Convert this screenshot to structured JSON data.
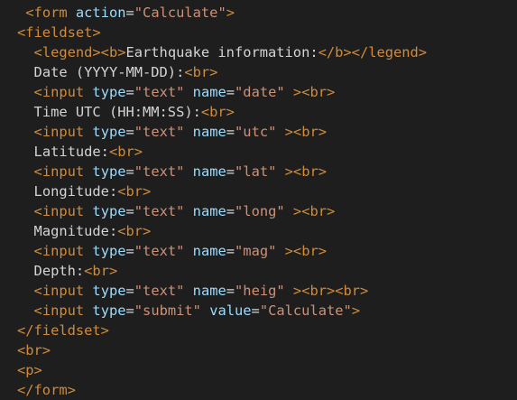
{
  "lines": [
    [
      {
        "t": " ",
        "c": "txt"
      },
      {
        "t": "<form ",
        "c": "tag"
      },
      {
        "t": "action",
        "c": "attr"
      },
      {
        "t": "=",
        "c": "eq"
      },
      {
        "t": "\"Calculate\"",
        "c": "str"
      },
      {
        "t": ">",
        "c": "tag"
      }
    ],
    [
      {
        "t": "<fieldset>",
        "c": "tag"
      }
    ],
    [
      {
        "t": "  ",
        "c": "txt"
      },
      {
        "t": "<legend><b>",
        "c": "tag"
      },
      {
        "t": "Earthquake information:",
        "c": "txt"
      },
      {
        "t": "</b></legend>",
        "c": "tag"
      }
    ],
    [
      {
        "t": "  ",
        "c": "txt"
      },
      {
        "t": "Date (YYYY-MM-DD):",
        "c": "txt"
      },
      {
        "t": "<br>",
        "c": "tag"
      }
    ],
    [
      {
        "t": "  ",
        "c": "txt"
      },
      {
        "t": "<input ",
        "c": "tag"
      },
      {
        "t": "type",
        "c": "attr"
      },
      {
        "t": "=",
        "c": "eq"
      },
      {
        "t": "\"text\"",
        "c": "str"
      },
      {
        "t": " ",
        "c": "txt"
      },
      {
        "t": "name",
        "c": "attr"
      },
      {
        "t": "=",
        "c": "eq"
      },
      {
        "t": "\"date\"",
        "c": "str"
      },
      {
        "t": " ",
        "c": "txt"
      },
      {
        "t": "><br>",
        "c": "tag"
      }
    ],
    [
      {
        "t": "  ",
        "c": "txt"
      },
      {
        "t": "Time UTC (HH:MM:SS):",
        "c": "txt"
      },
      {
        "t": "<br>",
        "c": "tag"
      }
    ],
    [
      {
        "t": "  ",
        "c": "txt"
      },
      {
        "t": "<input ",
        "c": "tag"
      },
      {
        "t": "type",
        "c": "attr"
      },
      {
        "t": "=",
        "c": "eq"
      },
      {
        "t": "\"text\"",
        "c": "str"
      },
      {
        "t": " ",
        "c": "txt"
      },
      {
        "t": "name",
        "c": "attr"
      },
      {
        "t": "=",
        "c": "eq"
      },
      {
        "t": "\"utc\"",
        "c": "str"
      },
      {
        "t": " ",
        "c": "txt"
      },
      {
        "t": "><br>",
        "c": "tag"
      }
    ],
    [
      {
        "t": "  ",
        "c": "txt"
      },
      {
        "t": "Latitude:",
        "c": "txt"
      },
      {
        "t": "<br>",
        "c": "tag"
      }
    ],
    [
      {
        "t": "  ",
        "c": "txt"
      },
      {
        "t": "<input ",
        "c": "tag"
      },
      {
        "t": "type",
        "c": "attr"
      },
      {
        "t": "=",
        "c": "eq"
      },
      {
        "t": "\"text\"",
        "c": "str"
      },
      {
        "t": " ",
        "c": "txt"
      },
      {
        "t": "name",
        "c": "attr"
      },
      {
        "t": "=",
        "c": "eq"
      },
      {
        "t": "\"lat\"",
        "c": "str"
      },
      {
        "t": " ",
        "c": "txt"
      },
      {
        "t": "><br>",
        "c": "tag"
      }
    ],
    [
      {
        "t": "  ",
        "c": "txt"
      },
      {
        "t": "Longitude:",
        "c": "txt"
      },
      {
        "t": "<br>",
        "c": "tag"
      }
    ],
    [
      {
        "t": "  ",
        "c": "txt"
      },
      {
        "t": "<input ",
        "c": "tag"
      },
      {
        "t": "type",
        "c": "attr"
      },
      {
        "t": "=",
        "c": "eq"
      },
      {
        "t": "\"text\"",
        "c": "str"
      },
      {
        "t": " ",
        "c": "txt"
      },
      {
        "t": "name",
        "c": "attr"
      },
      {
        "t": "=",
        "c": "eq"
      },
      {
        "t": "\"long\"",
        "c": "str"
      },
      {
        "t": " ",
        "c": "txt"
      },
      {
        "t": "><br>",
        "c": "tag"
      }
    ],
    [
      {
        "t": "  ",
        "c": "txt"
      },
      {
        "t": "Magnitude:",
        "c": "txt"
      },
      {
        "t": "<br>",
        "c": "tag"
      }
    ],
    [
      {
        "t": "  ",
        "c": "txt"
      },
      {
        "t": "<input ",
        "c": "tag"
      },
      {
        "t": "type",
        "c": "attr"
      },
      {
        "t": "=",
        "c": "eq"
      },
      {
        "t": "\"text\"",
        "c": "str"
      },
      {
        "t": " ",
        "c": "txt"
      },
      {
        "t": "name",
        "c": "attr"
      },
      {
        "t": "=",
        "c": "eq"
      },
      {
        "t": "\"mag\"",
        "c": "str"
      },
      {
        "t": " ",
        "c": "txt"
      },
      {
        "t": "><br>",
        "c": "tag"
      }
    ],
    [
      {
        "t": "  ",
        "c": "txt"
      },
      {
        "t": "Depth:",
        "c": "txt"
      },
      {
        "t": "<br>",
        "c": "tag"
      }
    ],
    [
      {
        "t": "  ",
        "c": "txt"
      },
      {
        "t": "<input ",
        "c": "tag"
      },
      {
        "t": "type",
        "c": "attr"
      },
      {
        "t": "=",
        "c": "eq"
      },
      {
        "t": "\"text\"",
        "c": "str"
      },
      {
        "t": " ",
        "c": "txt"
      },
      {
        "t": "name",
        "c": "attr"
      },
      {
        "t": "=",
        "c": "eq"
      },
      {
        "t": "\"heig\"",
        "c": "str"
      },
      {
        "t": " ",
        "c": "txt"
      },
      {
        "t": "><br><br>",
        "c": "tag"
      }
    ],
    [
      {
        "t": "  ",
        "c": "txt"
      },
      {
        "t": "<input ",
        "c": "tag"
      },
      {
        "t": "type",
        "c": "attr"
      },
      {
        "t": "=",
        "c": "eq"
      },
      {
        "t": "\"submit\"",
        "c": "str"
      },
      {
        "t": " ",
        "c": "txt"
      },
      {
        "t": "value",
        "c": "attr"
      },
      {
        "t": "=",
        "c": "eq"
      },
      {
        "t": "\"Calculate\"",
        "c": "str"
      },
      {
        "t": ">",
        "c": "tag"
      }
    ],
    [
      {
        "t": "</fieldset>",
        "c": "tag"
      }
    ],
    [
      {
        "t": "<br>",
        "c": "tag"
      }
    ],
    [
      {
        "t": "<p>",
        "c": "tag"
      }
    ],
    [
      {
        "t": "</form>",
        "c": "tag"
      }
    ]
  ]
}
